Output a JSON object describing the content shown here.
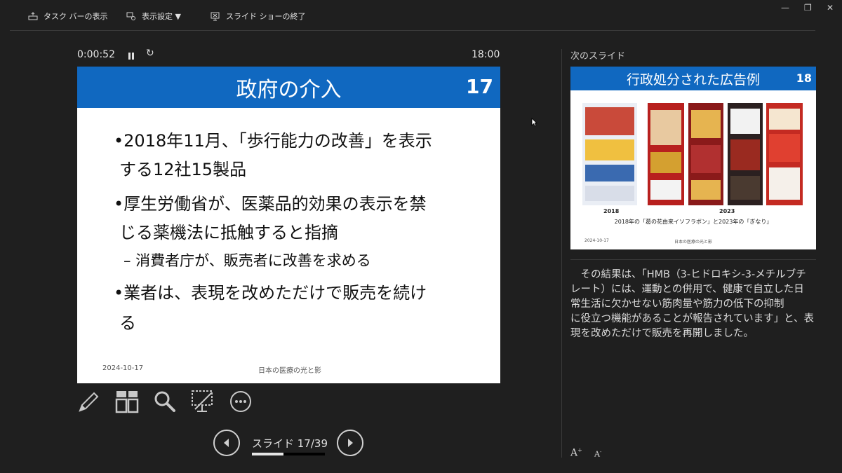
{
  "toolbar": {
    "taskbar_label": "タスク バーの表示",
    "display_settings_label": "表示設定 ▼",
    "end_show_label": "スライド ショーの終了"
  },
  "window_controls": {
    "minimize": "—",
    "restore": "❐",
    "close": "✕"
  },
  "timer": {
    "elapsed": "0:00:52",
    "reset_glyph": "↻",
    "clock": "18:00"
  },
  "current_slide": {
    "title": "政府の介入",
    "number": "17",
    "bullets": [
      {
        "line1": "•2018年11月、「歩行能力の改善」を表示",
        "line2": "する12社15製品"
      },
      {
        "line1": "•厚生労働省が、医薬品的効果の表示を禁",
        "line2": "じる薬機法に抵触すると指摘"
      },
      {
        "line1": "•業者は、表現を改めただけで販売を続け",
        "line2": "る"
      }
    ],
    "sub_bullet": "– 消費者庁が、販売者に改善を求める",
    "date": "2024-10-17",
    "footer": "日本の医療の光と影"
  },
  "tools": {
    "pen": "pen-icon",
    "slides": "all-slides-icon",
    "zoom": "zoom-icon",
    "black_screen": "black-screen-icon",
    "more": "more-options-icon"
  },
  "navigation": {
    "counter": "スライド 17/39",
    "progress_fraction": 0.436
  },
  "next_slide": {
    "label": "次のスライド",
    "title": "行政処分された広告例",
    "number": "18",
    "year_left": "2018",
    "year_right": "2023",
    "caption": "2018年の「葛の花由来イソフラボン」と2023年の「ぎなり」",
    "date": "2024-10-17",
    "footer": "日本の医療の光と影"
  },
  "notes": {
    "lines": [
      "　その結果は、「HMB（3-ヒドロキシ-3-メチルブチ",
      "レート）には、運動との併用で、健康で自立した日",
      "常生活に欠かせない筋肉量や筋力の低下の抑制",
      "に役立つ機能があることが報告されています」と、表",
      "現を改めただけで販売を再開しました。"
    ]
  },
  "font_controls": {
    "increase": "A",
    "decrease": "A"
  },
  "colors": {
    "background": "#1f1f1f",
    "slide_header": "#1068c0"
  }
}
